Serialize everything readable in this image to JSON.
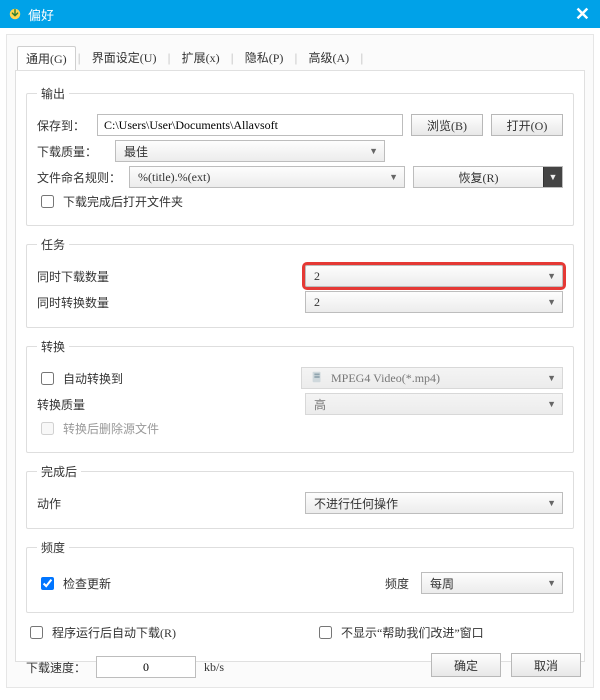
{
  "window": {
    "title": "偏好"
  },
  "tabs": {
    "items": [
      "通用(G)",
      "界面设定(U)",
      "扩展(x)",
      "隐私(P)",
      "高级(A)"
    ]
  },
  "output": {
    "legend": "输出",
    "save_to_label": "保存到：",
    "save_to_value": "C:\\Users\\User\\Documents\\Allavsoft",
    "browse_label": "浏览(B)",
    "open_label": "打开(O)",
    "quality_label": "下载质量：",
    "quality_value": "最佳",
    "filename_label": "文件命名规则：",
    "filename_value": "%(title).%(ext)",
    "restore_label": "恢复(R)",
    "open_folder_after": "下载完成后打开文件夹"
  },
  "tasks": {
    "legend": "任务",
    "simul_dl_label": "同时下载数量",
    "simul_dl_value": "2",
    "simul_cv_label": "同时转换数量",
    "simul_cv_value": "2"
  },
  "convert": {
    "legend": "转换",
    "auto_convert_to": "自动转换到",
    "format_value": "MPEG4 Video(*.mp4)",
    "quality_label": "转换质量",
    "quality_value": "高",
    "delete_source": "转换后删除源文件"
  },
  "after": {
    "legend": "完成后",
    "action_label": "动作",
    "action_value": "不进行任何操作"
  },
  "frequency": {
    "legend": "频度",
    "check_updates": "检查更新",
    "freq_label": "频度",
    "freq_value": "每周"
  },
  "misc": {
    "autodl_after_start": "程序运行后自动下载(R)",
    "hide_help_window": "不显示“帮助我们改进”窗口",
    "speed_label": "下载速度：",
    "speed_value": "0",
    "speed_unit": "kb/s"
  },
  "buttons": {
    "ok": "确定",
    "cancel": "取消"
  }
}
